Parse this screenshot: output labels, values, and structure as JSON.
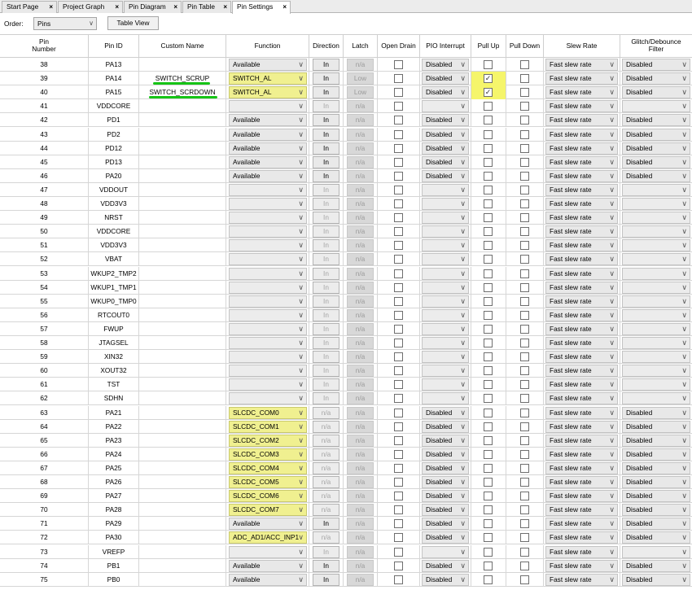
{
  "tabs": [
    {
      "label": "Start Page",
      "active": false
    },
    {
      "label": "Project Graph",
      "active": false
    },
    {
      "label": "Pin Diagram",
      "active": false
    },
    {
      "label": "Pin Table",
      "active": false
    },
    {
      "label": "Pin Settings",
      "active": true
    }
  ],
  "tab_close_glyph": "×",
  "toolbar": {
    "order_label": "Order:",
    "order_value": "Pins",
    "table_view_label": "Table View"
  },
  "columns": {
    "pin_number": "Pin Number",
    "pin_id": "Pin ID",
    "custom_name": "Custom Name",
    "function": "Function",
    "direction": "Direction",
    "latch": "Latch",
    "open_drain": "Open Drain",
    "pio_interrupt": "PIO Interrupt",
    "pull_up": "Pull Up",
    "pull_down": "Pull Down",
    "slew_rate": "Slew Rate",
    "glitch_filter": "Glitch/Debounce Filter"
  },
  "rows": [
    {
      "num": "38",
      "id": "PA13",
      "custom": "",
      "func": "Available",
      "dir": "In",
      "latch": "n/a",
      "pio": "Disabled",
      "pullup": false,
      "slew": "Fast slew rate",
      "glitch": "Disabled",
      "active": true,
      "hl": false
    },
    {
      "num": "39",
      "id": "PA14",
      "custom": "SWITCH_SCRUP",
      "func": "SWITCH_AL",
      "dir": "In",
      "latch": "Low",
      "pio": "Disabled",
      "pullup": true,
      "slew": "Fast slew rate",
      "glitch": "Disabled",
      "active": true,
      "hl": true
    },
    {
      "num": "40",
      "id": "PA15",
      "custom": "SWITCH_SCRDOWN",
      "func": "SWITCH_AL",
      "dir": "In",
      "latch": "Low",
      "pio": "Disabled",
      "pullup": true,
      "slew": "Fast slew rate",
      "glitch": "Disabled",
      "active": true,
      "hl": true
    },
    {
      "num": "41",
      "id": "VDDCORE",
      "custom": "",
      "func": "",
      "dir": "In",
      "latch": "n/a",
      "pio": "",
      "pullup": false,
      "slew": "Fast slew rate",
      "glitch": "",
      "active": false,
      "hl": false
    },
    {
      "num": "42",
      "id": "PD1",
      "custom": "",
      "func": "Available",
      "dir": "In",
      "latch": "n/a",
      "pio": "Disabled",
      "pullup": false,
      "slew": "Fast slew rate",
      "glitch": "Disabled",
      "active": true,
      "hl": false
    },
    {
      "num": "43",
      "id": "PD2",
      "custom": "",
      "func": "Available",
      "dir": "In",
      "latch": "n/a",
      "pio": "Disabled",
      "pullup": false,
      "slew": "Fast slew rate",
      "glitch": "Disabled",
      "active": true,
      "hl": false
    },
    {
      "num": "44",
      "id": "PD12",
      "custom": "",
      "func": "Available",
      "dir": "In",
      "latch": "n/a",
      "pio": "Disabled",
      "pullup": false,
      "slew": "Fast slew rate",
      "glitch": "Disabled",
      "active": true,
      "hl": false
    },
    {
      "num": "45",
      "id": "PD13",
      "custom": "",
      "func": "Available",
      "dir": "In",
      "latch": "n/a",
      "pio": "Disabled",
      "pullup": false,
      "slew": "Fast slew rate",
      "glitch": "Disabled",
      "active": true,
      "hl": false
    },
    {
      "num": "46",
      "id": "PA20",
      "custom": "",
      "func": "Available",
      "dir": "In",
      "latch": "n/a",
      "pio": "Disabled",
      "pullup": false,
      "slew": "Fast slew rate",
      "glitch": "Disabled",
      "active": true,
      "hl": false
    },
    {
      "num": "47",
      "id": "VDDOUT",
      "custom": "",
      "func": "",
      "dir": "In",
      "latch": "n/a",
      "pio": "",
      "pullup": false,
      "slew": "Fast slew rate",
      "glitch": "",
      "active": false,
      "hl": false
    },
    {
      "num": "48",
      "id": "VDD3V3",
      "custom": "",
      "func": "",
      "dir": "In",
      "latch": "n/a",
      "pio": "",
      "pullup": false,
      "slew": "Fast slew rate",
      "glitch": "",
      "active": false,
      "hl": false
    },
    {
      "num": "49",
      "id": "NRST",
      "custom": "",
      "func": "",
      "dir": "In",
      "latch": "n/a",
      "pio": "",
      "pullup": false,
      "slew": "Fast slew rate",
      "glitch": "",
      "active": false,
      "hl": false
    },
    {
      "num": "50",
      "id": "VDDCORE",
      "custom": "",
      "func": "",
      "dir": "In",
      "latch": "n/a",
      "pio": "",
      "pullup": false,
      "slew": "Fast slew rate",
      "glitch": "",
      "active": false,
      "hl": false
    },
    {
      "num": "51",
      "id": "VDD3V3",
      "custom": "",
      "func": "",
      "dir": "In",
      "latch": "n/a",
      "pio": "",
      "pullup": false,
      "slew": "Fast slew rate",
      "glitch": "",
      "active": false,
      "hl": false
    },
    {
      "num": "52",
      "id": "VBAT",
      "custom": "",
      "func": "",
      "dir": "In",
      "latch": "n/a",
      "pio": "",
      "pullup": false,
      "slew": "Fast slew rate",
      "glitch": "",
      "active": false,
      "hl": false
    },
    {
      "num": "53",
      "id": "WKUP2_TMP2",
      "custom": "",
      "func": "",
      "dir": "In",
      "latch": "n/a",
      "pio": "",
      "pullup": false,
      "slew": "Fast slew rate",
      "glitch": "",
      "active": false,
      "hl": false
    },
    {
      "num": "54",
      "id": "WKUP1_TMP1",
      "custom": "",
      "func": "",
      "dir": "In",
      "latch": "n/a",
      "pio": "",
      "pullup": false,
      "slew": "Fast slew rate",
      "glitch": "",
      "active": false,
      "hl": false
    },
    {
      "num": "55",
      "id": "WKUP0_TMP0",
      "custom": "",
      "func": "",
      "dir": "In",
      "latch": "n/a",
      "pio": "",
      "pullup": false,
      "slew": "Fast slew rate",
      "glitch": "",
      "active": false,
      "hl": false
    },
    {
      "num": "56",
      "id": "RTCOUT0",
      "custom": "",
      "func": "",
      "dir": "In",
      "latch": "n/a",
      "pio": "",
      "pullup": false,
      "slew": "Fast slew rate",
      "glitch": "",
      "active": false,
      "hl": false
    },
    {
      "num": "57",
      "id": "FWUP",
      "custom": "",
      "func": "",
      "dir": "In",
      "latch": "n/a",
      "pio": "",
      "pullup": false,
      "slew": "Fast slew rate",
      "glitch": "",
      "active": false,
      "hl": false
    },
    {
      "num": "58",
      "id": "JTAGSEL",
      "custom": "",
      "func": "",
      "dir": "In",
      "latch": "n/a",
      "pio": "",
      "pullup": false,
      "slew": "Fast slew rate",
      "glitch": "",
      "active": false,
      "hl": false
    },
    {
      "num": "59",
      "id": "XIN32",
      "custom": "",
      "func": "",
      "dir": "In",
      "latch": "n/a",
      "pio": "",
      "pullup": false,
      "slew": "Fast slew rate",
      "glitch": "",
      "active": false,
      "hl": false
    },
    {
      "num": "60",
      "id": "XOUT32",
      "custom": "",
      "func": "",
      "dir": "In",
      "latch": "n/a",
      "pio": "",
      "pullup": false,
      "slew": "Fast slew rate",
      "glitch": "",
      "active": false,
      "hl": false
    },
    {
      "num": "61",
      "id": "TST",
      "custom": "",
      "func": "",
      "dir": "In",
      "latch": "n/a",
      "pio": "",
      "pullup": false,
      "slew": "Fast slew rate",
      "glitch": "",
      "active": false,
      "hl": false
    },
    {
      "num": "62",
      "id": "SDHN",
      "custom": "",
      "func": "",
      "dir": "In",
      "latch": "n/a",
      "pio": "",
      "pullup": false,
      "slew": "Fast slew rate",
      "glitch": "",
      "active": false,
      "hl": false
    },
    {
      "num": "63",
      "id": "PA21",
      "custom": "",
      "func": "SLCDC_COM0",
      "dir": "n/a",
      "latch": "n/a",
      "pio": "Disabled",
      "pullup": false,
      "slew": "Fast slew rate",
      "glitch": "Disabled",
      "active": true,
      "hl": true,
      "dirdim": true
    },
    {
      "num": "64",
      "id": "PA22",
      "custom": "",
      "func": "SLCDC_COM1",
      "dir": "n/a",
      "latch": "n/a",
      "pio": "Disabled",
      "pullup": false,
      "slew": "Fast slew rate",
      "glitch": "Disabled",
      "active": true,
      "hl": true,
      "dirdim": true
    },
    {
      "num": "65",
      "id": "PA23",
      "custom": "",
      "func": "SLCDC_COM2",
      "dir": "n/a",
      "latch": "n/a",
      "pio": "Disabled",
      "pullup": false,
      "slew": "Fast slew rate",
      "glitch": "Disabled",
      "active": true,
      "hl": true,
      "dirdim": true
    },
    {
      "num": "66",
      "id": "PA24",
      "custom": "",
      "func": "SLCDC_COM3",
      "dir": "n/a",
      "latch": "n/a",
      "pio": "Disabled",
      "pullup": false,
      "slew": "Fast slew rate",
      "glitch": "Disabled",
      "active": true,
      "hl": true,
      "dirdim": true
    },
    {
      "num": "67",
      "id": "PA25",
      "custom": "",
      "func": "SLCDC_COM4",
      "dir": "n/a",
      "latch": "n/a",
      "pio": "Disabled",
      "pullup": false,
      "slew": "Fast slew rate",
      "glitch": "Disabled",
      "active": true,
      "hl": true,
      "dirdim": true
    },
    {
      "num": "68",
      "id": "PA26",
      "custom": "",
      "func": "SLCDC_COM5",
      "dir": "n/a",
      "latch": "n/a",
      "pio": "Disabled",
      "pullup": false,
      "slew": "Fast slew rate",
      "glitch": "Disabled",
      "active": true,
      "hl": true,
      "dirdim": true
    },
    {
      "num": "69",
      "id": "PA27",
      "custom": "",
      "func": "SLCDC_COM6",
      "dir": "n/a",
      "latch": "n/a",
      "pio": "Disabled",
      "pullup": false,
      "slew": "Fast slew rate",
      "glitch": "Disabled",
      "active": true,
      "hl": true,
      "dirdim": true
    },
    {
      "num": "70",
      "id": "PA28",
      "custom": "",
      "func": "SLCDC_COM7",
      "dir": "n/a",
      "latch": "n/a",
      "pio": "Disabled",
      "pullup": false,
      "slew": "Fast slew rate",
      "glitch": "Disabled",
      "active": true,
      "hl": true,
      "dirdim": true
    },
    {
      "num": "71",
      "id": "PA29",
      "custom": "",
      "func": "Available",
      "dir": "In",
      "latch": "n/a",
      "pio": "Disabled",
      "pullup": false,
      "slew": "Fast slew rate",
      "glitch": "Disabled",
      "active": true,
      "hl": false
    },
    {
      "num": "72",
      "id": "PA30",
      "custom": "",
      "func": "ADC_AD1/ACC_INP1",
      "dir": "n/a",
      "latch": "n/a",
      "pio": "Disabled",
      "pullup": false,
      "slew": "Fast slew rate",
      "glitch": "Disabled",
      "active": true,
      "hl": true,
      "dirdim": true
    },
    {
      "num": "73",
      "id": "VREFP",
      "custom": "",
      "func": "",
      "dir": "In",
      "latch": "n/a",
      "pio": "",
      "pullup": false,
      "slew": "Fast slew rate",
      "glitch": "",
      "active": false,
      "hl": false
    },
    {
      "num": "74",
      "id": "PB1",
      "custom": "",
      "func": "Available",
      "dir": "In",
      "latch": "n/a",
      "pio": "Disabled",
      "pullup": false,
      "slew": "Fast slew rate",
      "glitch": "Disabled",
      "active": true,
      "hl": false
    },
    {
      "num": "75",
      "id": "PB0",
      "custom": "",
      "func": "Available",
      "dir": "In",
      "latch": "n/a",
      "pio": "Disabled",
      "pullup": false,
      "slew": "Fast slew rate",
      "glitch": "Disabled",
      "active": true,
      "hl": false
    }
  ],
  "colors": {
    "highlight_yellow": "#f5f56b",
    "annotation_green": "#16c416"
  },
  "icons": {
    "dropdown": "chevron-down-icon",
    "close": "close-icon",
    "check": "checkmark-icon"
  }
}
